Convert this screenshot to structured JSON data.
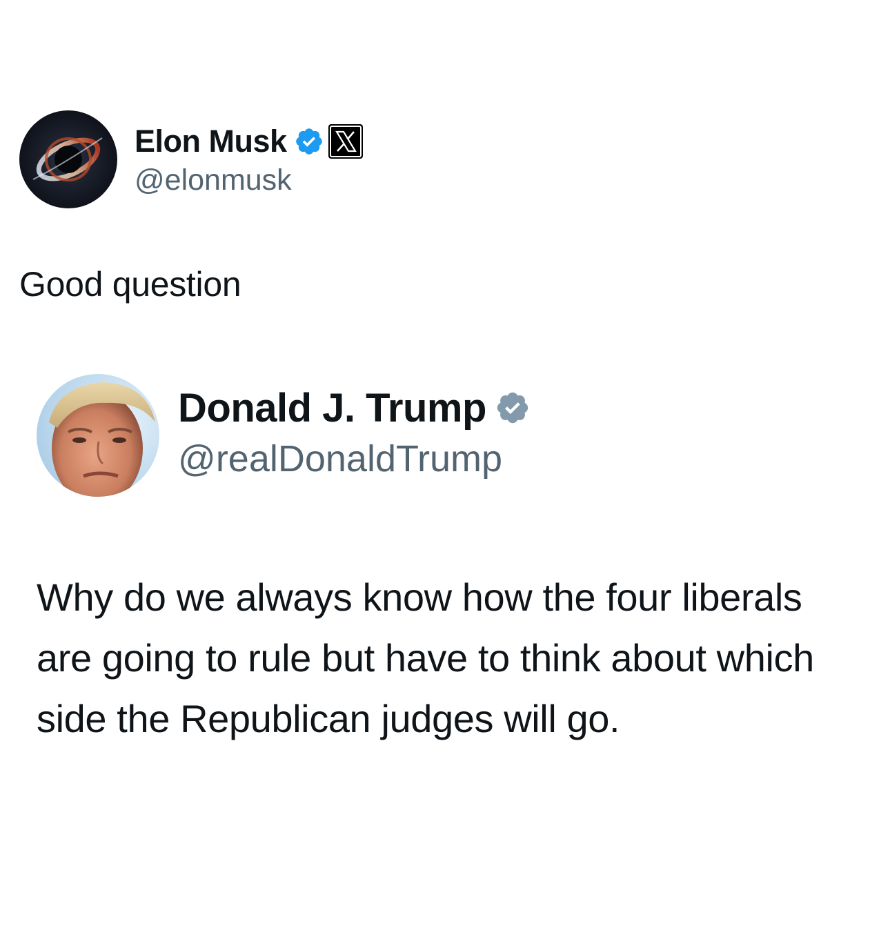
{
  "outer_tweet": {
    "display_name": "Elon Musk",
    "handle": "@elonmusk",
    "verified_icon": "blue-verified-badge",
    "affiliation_icon": "x-logo",
    "text": "Good question"
  },
  "quoted_tweet": {
    "display_name": "Donald J. Trump",
    "handle": "@realDonaldTrump",
    "verified_icon": "gray-verified-badge",
    "text": "Why do we always know how the four liberals are going to rule but have to think about which side the Republican judges will go."
  },
  "colors": {
    "text_primary": "#0f1419",
    "text_secondary": "#536471",
    "verified_blue": "#1d9bf0",
    "verified_gray": "#829aab"
  }
}
